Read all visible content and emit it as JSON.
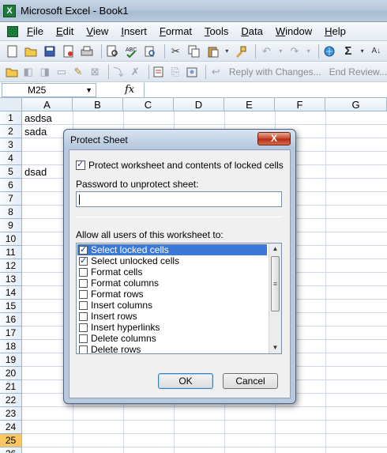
{
  "window": {
    "title": "Microsoft Excel - Book1",
    "app_icon": "X"
  },
  "menu": [
    "File",
    "Edit",
    "View",
    "Insert",
    "Format",
    "Tools",
    "Data",
    "Window",
    "Help"
  ],
  "toolbar2": {
    "reply_label": "Reply with Changes...",
    "end_review_label": "End Review..."
  },
  "formula_bar": {
    "name_box": "M25",
    "fx": "fx"
  },
  "grid": {
    "columns": [
      "A",
      "B",
      "C",
      "D",
      "E",
      "F",
      "G"
    ],
    "rows": [
      "1",
      "2",
      "3",
      "4",
      "5",
      "6",
      "7",
      "8",
      "9",
      "10",
      "11",
      "12",
      "13",
      "14",
      "15",
      "16",
      "17",
      "18",
      "19",
      "20",
      "21",
      "22",
      "23",
      "24",
      "25",
      "26"
    ],
    "active_row": "25",
    "cells": {
      "a1": "asdsa",
      "a2": "sada",
      "a5": "dsad"
    }
  },
  "dialog": {
    "title": "Protect Sheet",
    "close_label": "X",
    "protect_label": "Protect worksheet and contents of locked cells",
    "protect_checked": true,
    "password_label": "Password to unprotect sheet:",
    "password_value": "",
    "allow_label": "Allow all users of this worksheet to:",
    "permissions": [
      {
        "label": "Select locked cells",
        "checked": true,
        "selected": true
      },
      {
        "label": "Select unlocked cells",
        "checked": true,
        "selected": false
      },
      {
        "label": "Format cells",
        "checked": false,
        "selected": false
      },
      {
        "label": "Format columns",
        "checked": false,
        "selected": false
      },
      {
        "label": "Format rows",
        "checked": false,
        "selected": false
      },
      {
        "label": "Insert columns",
        "checked": false,
        "selected": false
      },
      {
        "label": "Insert rows",
        "checked": false,
        "selected": false
      },
      {
        "label": "Insert hyperlinks",
        "checked": false,
        "selected": false
      },
      {
        "label": "Delete columns",
        "checked": false,
        "selected": false
      },
      {
        "label": "Delete rows",
        "checked": false,
        "selected": false
      }
    ],
    "ok_label": "OK",
    "cancel_label": "Cancel"
  }
}
